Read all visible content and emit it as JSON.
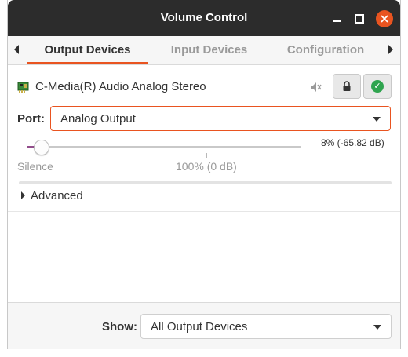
{
  "window": {
    "title": "Volume Control",
    "accent_color": "#e95420",
    "titlebar_color": "#2c2c2c"
  },
  "tabs": [
    {
      "label": "Output Devices",
      "active": true
    },
    {
      "label": "Input Devices",
      "active": false
    },
    {
      "label": "Configuration",
      "active": false
    }
  ],
  "device": {
    "name": "C-Media(R) Audio Analog Stereo",
    "icon": "sound-card-icon",
    "port_label": "Port:",
    "port_value": "Analog Output",
    "volume": {
      "level_percent": 8,
      "value_text": "8% (-65.82 dB)",
      "mark_silence": "Silence",
      "mark_100": "100% (0 dB)",
      "fill_color": "#924d8b"
    },
    "mute_icon": "speaker-muted-icon",
    "lock_icon": "lock-icon",
    "default_icon": "check-icon"
  },
  "advanced": {
    "label": "Advanced"
  },
  "footer": {
    "show_label": "Show:",
    "show_value": "All Output Devices"
  }
}
